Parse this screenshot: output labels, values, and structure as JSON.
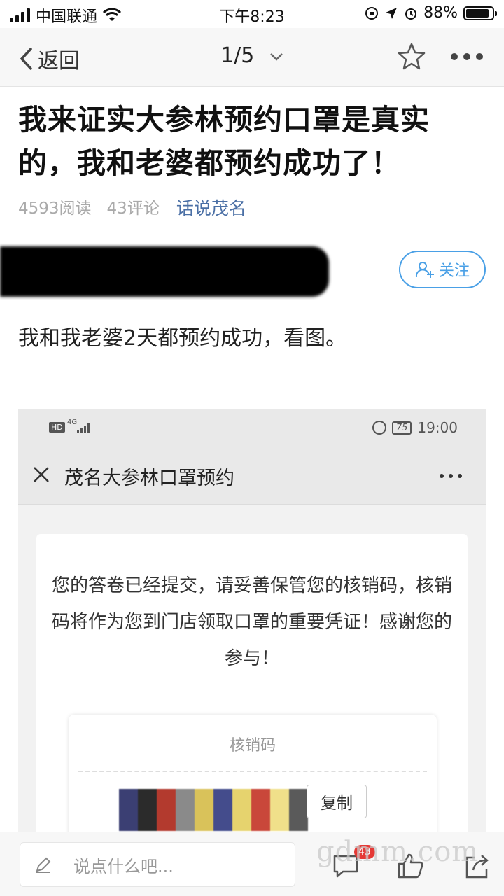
{
  "status_bar": {
    "carrier": "中国联通",
    "time": "下午8:23",
    "battery_percent_text": "88%",
    "battery_level": 0.88
  },
  "nav": {
    "back_label": "返回",
    "pager": "1/5"
  },
  "article": {
    "title": "我来证实大参林预约口罩是真实的，我和老婆都预约成功了！",
    "reads": "4593阅读",
    "comments": "43评论",
    "topic": "话说茂名",
    "follow_label": "关注",
    "body": "我和我老婆2天都预约成功，看图。"
  },
  "screenshot": {
    "network": "4G",
    "battery": "75",
    "time": "19:00",
    "title": "茂名大参林口罩预约",
    "message": "您的答卷已经提交，请妥善保管您的核销码，核销码将作为您到门店领取口罩的重要凭证！感谢您的参与！",
    "code_label": "核销码",
    "copy_label": "复制"
  },
  "bottom_bar": {
    "comment_placeholder": "说点什么吧...",
    "comment_badge": "43",
    "watermark": "gdmm.com"
  },
  "colors": {
    "accent_blue": "#4aa0e6",
    "topic_blue": "#4a6fa5",
    "badge_red": "#e53935"
  }
}
